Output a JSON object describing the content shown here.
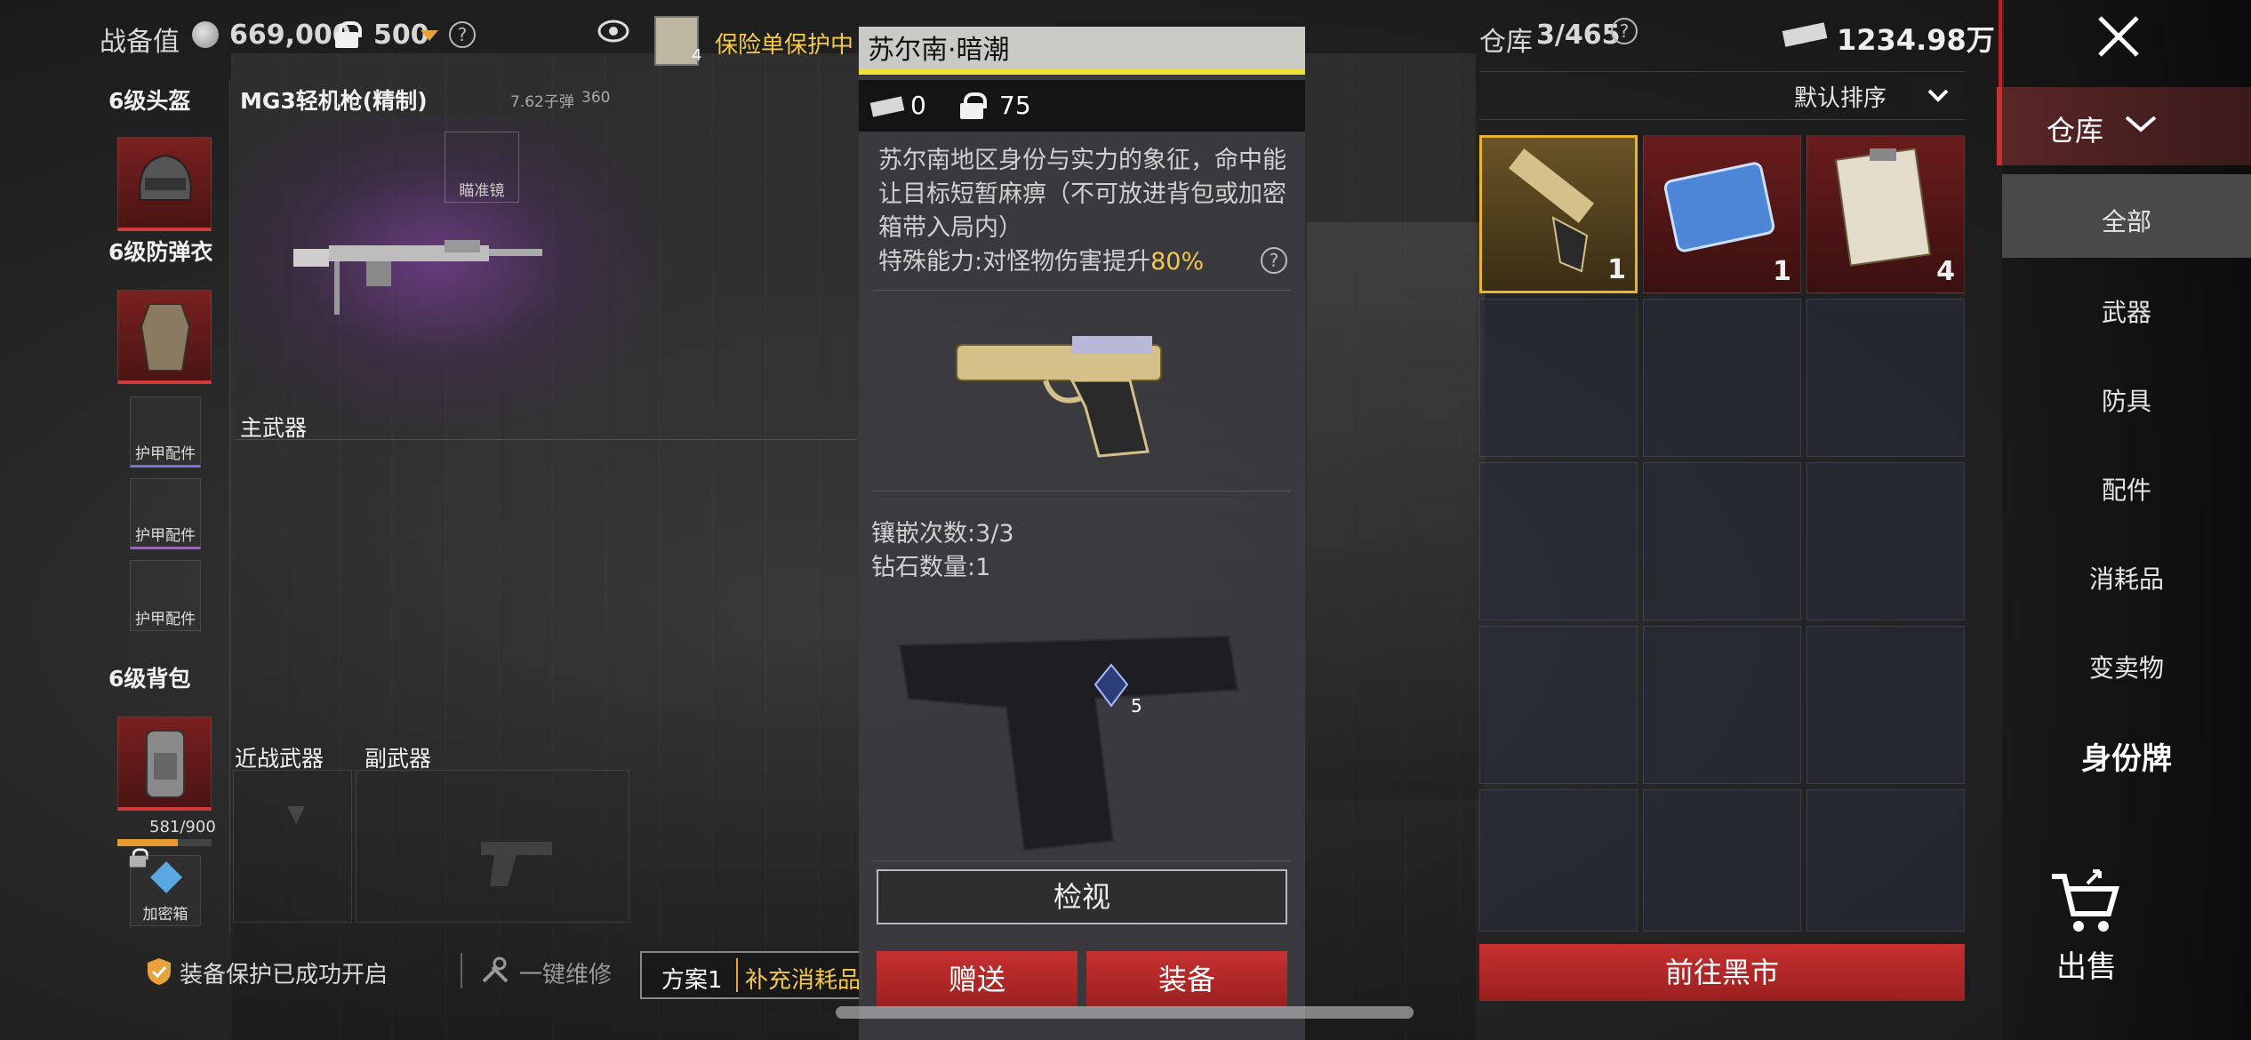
{
  "topbar": {
    "combat_value_label": "战备值",
    "combat_value": "669,000",
    "lock_value": "500",
    "insurance_count": "4",
    "insurance_label": "保险单保护中"
  },
  "warehouse_header": {
    "label": "仓库",
    "capacity": "3/465",
    "money": "1234.98万",
    "sort_label": "默认排序"
  },
  "loadout": {
    "helmet_label": "6级头盔",
    "armor_label": "6级防弹衣",
    "armor_part_label": "护甲配件",
    "backpack_label": "6级背包",
    "backpack_capacity": "581/900",
    "secure_box_label": "加密箱",
    "primary_weapon_name": "MG3轻机枪(精制)",
    "primary_ammo": "7.62子弹",
    "primary_ammo_count": "360",
    "scope_label": "瞄准镜",
    "primary_slot_label": "主武器",
    "melee_label": "近战武器",
    "secondary_label": "副武器"
  },
  "bottom_bar": {
    "protection_status": "装备保护已成功开启",
    "repair_label": "一键维修",
    "plan_label": "方案1",
    "supply_label": "补充消耗品"
  },
  "item_popup": {
    "title": "苏尔南·暗潮",
    "price": "0",
    "weight": "75",
    "description": "苏尔南地区身份与实力的象征，命中能让目标短暂麻痹（不可放进背包或加密箱带入局内）",
    "ability_prefix": "特殊能力:对怪物伤害提升",
    "ability_value": "80%",
    "inlay_count": "镶嵌次数:3/3",
    "diamond_count": "钻石数量:1",
    "gem_count": "5",
    "inspect_button": "检视",
    "gift_button": "赠送",
    "equip_button": "装备"
  },
  "warehouse_items": [
    {
      "name": "golden-pistol",
      "count": "1",
      "rarity": "gold"
    },
    {
      "name": "blue-card",
      "count": "1",
      "rarity": "red"
    },
    {
      "name": "document",
      "count": "4",
      "rarity": "red"
    }
  ],
  "black_market_button": "前往黑市",
  "sidebar": {
    "tab_warehouse": "仓库",
    "items": [
      "全部",
      "武器",
      "防具",
      "配件",
      "消耗品",
      "变卖物",
      "身份牌"
    ],
    "sell_label": "出售"
  },
  "colors": {
    "accent_red": "#c73030",
    "accent_gold": "#e8b530",
    "highlight_yellow": "#f2c94c"
  }
}
